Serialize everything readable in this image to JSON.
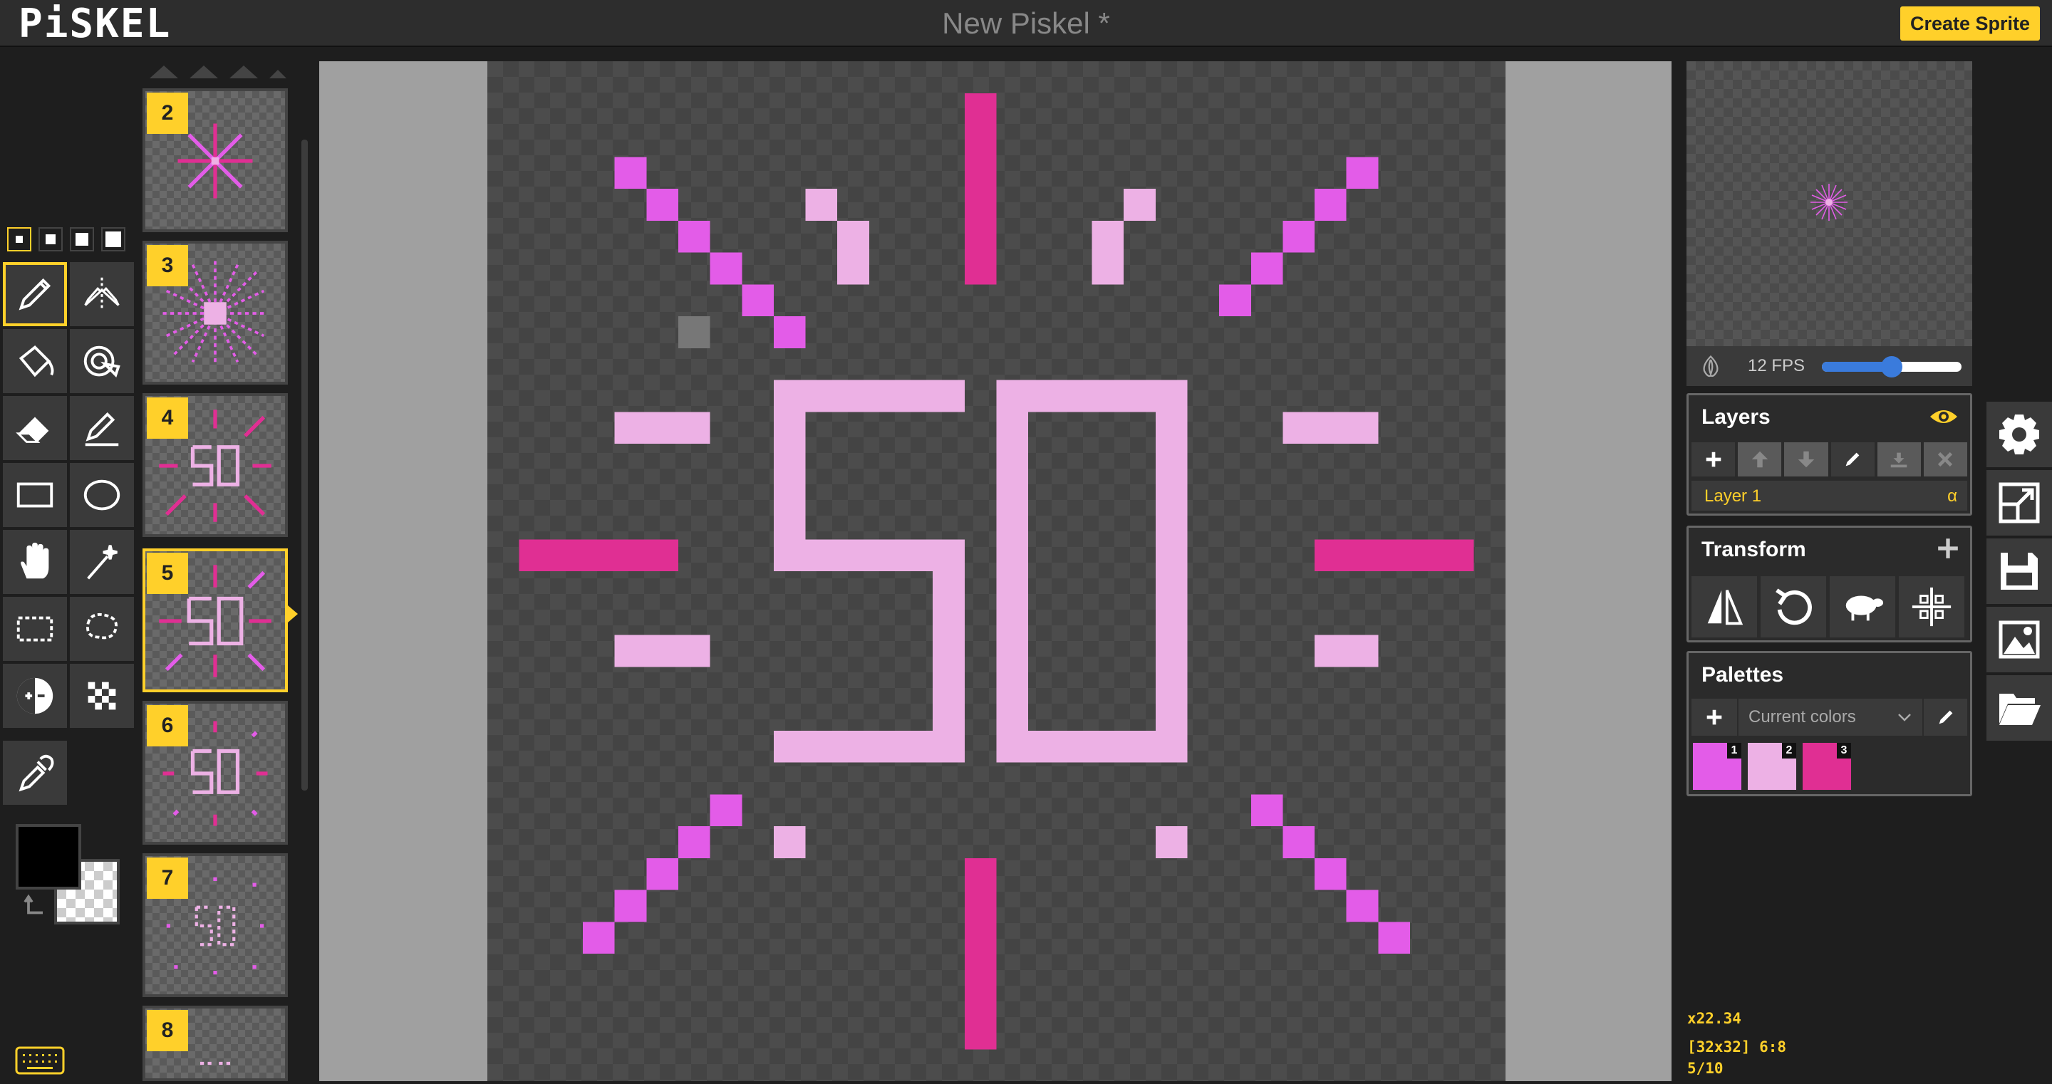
{
  "app": {
    "logo": "PiSKEL",
    "document_title": "New Piskel *",
    "create_sprite_label": "Create Sprite"
  },
  "toolbox": {
    "pen_sizes": [
      1,
      2,
      3,
      4
    ],
    "active_pen_size": 1,
    "tools": [
      {
        "name": "pen-tool",
        "icon": "pencil-icon",
        "active": true
      },
      {
        "name": "vertical-mirror-pen-tool",
        "icon": "mirror-pen-icon"
      },
      {
        "name": "paint-bucket-tool",
        "icon": "bucket-icon"
      },
      {
        "name": "paint-same-color-tool",
        "icon": "magic-bucket-icon"
      },
      {
        "name": "eraser-tool",
        "icon": "eraser-icon"
      },
      {
        "name": "stroke-tool",
        "icon": "line-icon"
      },
      {
        "name": "rectangle-tool",
        "icon": "rectangle-icon"
      },
      {
        "name": "circle-tool",
        "icon": "circle-icon"
      },
      {
        "name": "move-tool",
        "icon": "hand-icon"
      },
      {
        "name": "shape-selection-tool",
        "icon": "magic-wand-icon"
      },
      {
        "name": "rectangle-selection-tool",
        "icon": "rect-select-icon"
      },
      {
        "name": "lasso-selection-tool",
        "icon": "lasso-icon"
      },
      {
        "name": "lighten-tool",
        "icon": "lighten-darken-icon"
      },
      {
        "name": "dithering-tool",
        "icon": "dither-icon"
      },
      {
        "name": "color-picker-tool",
        "icon": "eyedropper-icon"
      }
    ],
    "primary_color": "#000000",
    "secondary_color": "transparent"
  },
  "frames": [
    {
      "number": "2"
    },
    {
      "number": "3"
    },
    {
      "number": "4"
    },
    {
      "number": "5",
      "active": true
    },
    {
      "number": "6"
    },
    {
      "number": "7"
    },
    {
      "number": "8"
    }
  ],
  "preview": {
    "fps_label": "12 FPS",
    "fps_fraction": 0.5
  },
  "layers": {
    "title": "Layers",
    "items": [
      {
        "name": "Layer 1",
        "alpha_label": "α"
      }
    ]
  },
  "transform": {
    "title": "Transform",
    "tools": [
      "flip-icon",
      "rotate-icon",
      "clone-sheep-icon",
      "align-center-icon"
    ]
  },
  "palettes": {
    "title": "Palettes",
    "selected": "Current colors",
    "swatches": [
      {
        "color": "#e35ce8",
        "index": "1"
      },
      {
        "color": "#edb1e5",
        "index": "2"
      },
      {
        "color": "#e02f93",
        "index": "3"
      }
    ]
  },
  "side_menu": [
    "gear-icon",
    "resize-icon",
    "save-icon",
    "export-image-icon",
    "open-folder-icon"
  ],
  "status": {
    "zoom": "x22.34",
    "size_and_cursor": "[32x32] 6:8",
    "frame_counter": "5/10"
  },
  "colors": {
    "accent": "#ffd02a",
    "pink_a": "#e35ce8",
    "pink_b": "#edb1e5",
    "pink_c": "#e02f93"
  }
}
